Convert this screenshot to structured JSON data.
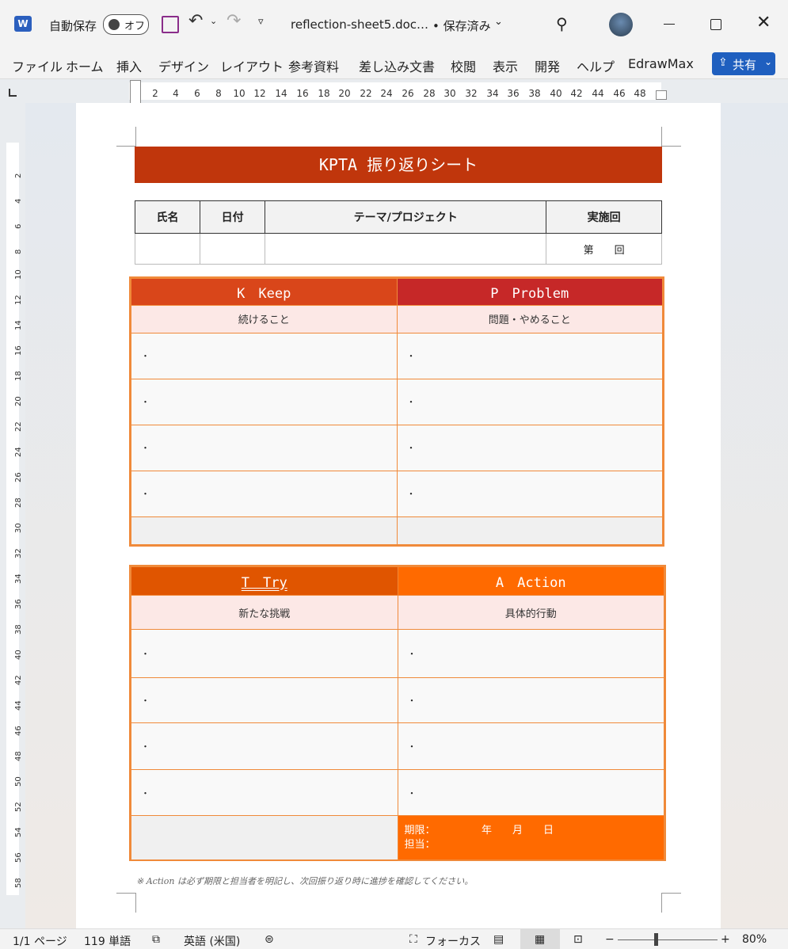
{
  "titlebar": {
    "app_icon": "word-icon",
    "autosave_label": "自動保存",
    "autosave_toggle": "オフ",
    "filename": "reflection-sheet5.doc…",
    "save_state": "• 保存済み"
  },
  "menu": [
    "ファイル",
    "ホーム",
    "挿入",
    "デザイン",
    "レイアウト",
    "参考資料",
    "差し込み文書",
    "校閲",
    "表示",
    "開発",
    "ヘルプ",
    "EdrawMax"
  ],
  "share_label": "共有",
  "ruler": [
    "2",
    "4",
    "6",
    "8",
    "10",
    "12",
    "14",
    "16",
    "18",
    "20",
    "22",
    "24",
    "26",
    "28",
    "30",
    "32",
    "34",
    "36",
    "38",
    "40",
    "42",
    "44",
    "46",
    "48"
  ],
  "vruler": [
    "2",
    "4",
    "6",
    "8",
    "10",
    "12",
    "14",
    "16",
    "18",
    "20",
    "22",
    "24",
    "26",
    "28",
    "30",
    "32",
    "34",
    "36",
    "38",
    "40",
    "42",
    "44",
    "46",
    "48",
    "50",
    "52",
    "54",
    "56",
    "58"
  ],
  "doc": {
    "title": "KPTA 振り返りシート",
    "info_headers": [
      "氏名",
      "日付",
      "テーマ/プロジェクト",
      "実施回"
    ],
    "info_values": [
      "",
      "",
      "",
      "第　　回"
    ],
    "keep": {
      "header": "K　Keep",
      "sub": "続けること",
      "bullets": [
        "・",
        "・",
        "・",
        "・"
      ]
    },
    "problem": {
      "header": "P　Problem",
      "sub": "問題・やめること",
      "bullets": [
        "・",
        "・",
        "・",
        "・"
      ]
    },
    "try": {
      "header": "T　Try",
      "sub": "新たな挑戦",
      "bullets": [
        "・",
        "・",
        "・",
        "・"
      ]
    },
    "action": {
      "header": "A　Action",
      "sub": "具体的行動",
      "bullets": [
        "・",
        "・",
        "・",
        "・"
      ],
      "deadline": "期限：　　　　　年　　月　　日",
      "owner": "担当："
    },
    "note": "※ Action は必ず期限と担当者を明記し、次回振り返り時に進捗を確認してください。"
  },
  "colors": {
    "title_bg": "#c0360c",
    "keep": "#d9461a",
    "problem": "#c62828",
    "try": "#e05500",
    "action": "#ff6a00",
    "border": "#f08a3a"
  },
  "status": {
    "page": "1/1 ページ",
    "words": "119 単語",
    "lang": "英語 (米国)",
    "focus": "フォーカス",
    "zoom": "80%"
  }
}
